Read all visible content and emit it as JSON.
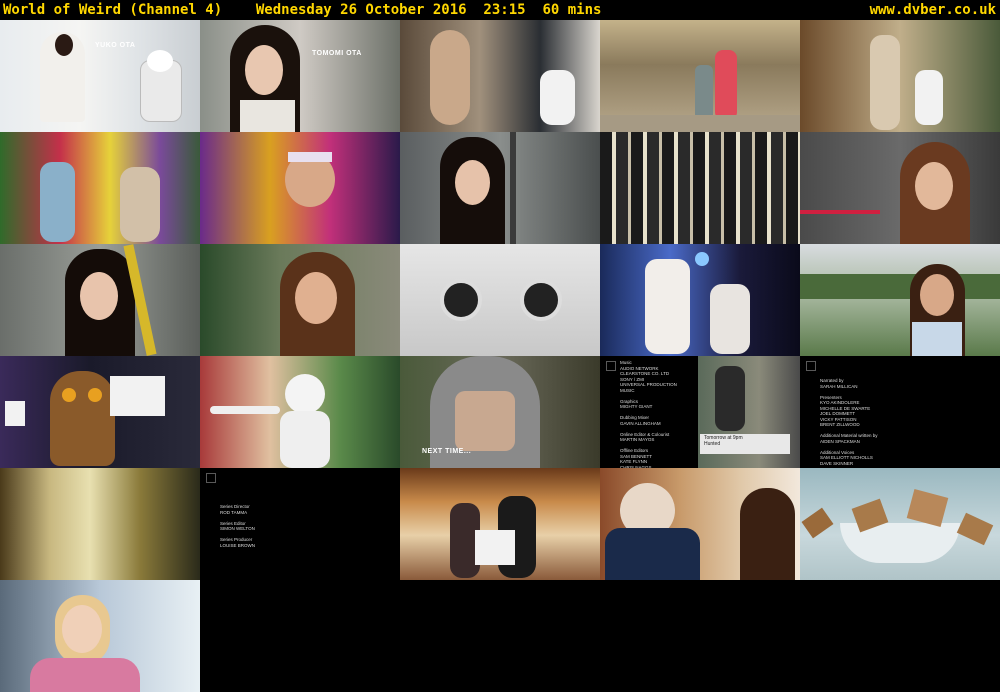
{
  "header": {
    "title": "World of Weird (Channel 4)    Wednesday 26 October 2016  23:15  60 mins",
    "site": "www.dvber.co.uk"
  },
  "captions": {
    "yuko": "YUKO OTA",
    "tomomi": "TOMOMI OTA",
    "next_time": "NEXT TIME..."
  },
  "credits": {
    "music": "Music\nAUDIO NETWORK\nCLEARSTONE CO. LTD\nSONY / ZMI\nUNIVERSAL PRODUCTION\nMUSIC\n\nGraphics\nMIGHTY GIANT\n\nDubbing Mixer\nGAVIN ALLINGHAM\n\nOnline Editor & Colourist\nMARTIN MAYOS\n\nOffline Editors\nSAM BENNETT\nKATE FLYNN\nCHRIS NAGGS\nSTEVE PARKER",
    "narrated": "Narrated by\nSARAH MILLICAN\n\nPresenters\nKYO AKINDOLERE\nMICHELLE DE SWARTE\nJOEL DOMMETT\nVICKY PATTISON\nBRENT ZILLWOOD\n\nAdditional Material written by\nAIDEN SPACKMAN\n\nAdditional Voices\nSAM ELLIOTT NICHOLLS\nDAVE SKINNER",
    "director": "Series Director\nROD TAMMA\n\nSeries Editor\nSIMON WELTON\n\nSeries Producer\nLOUISE BROWN",
    "hunted": "Tomorrow at 9pm\nHunted"
  }
}
